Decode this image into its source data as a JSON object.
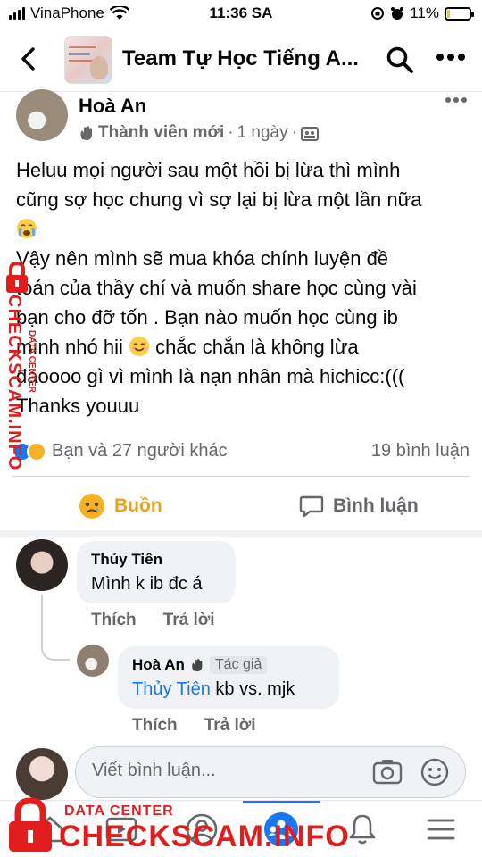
{
  "status_bar": {
    "carrier": "VinaPhone",
    "time": "11:36 SA",
    "battery": "11%",
    "battery_level": 0.11
  },
  "header": {
    "title": "Team Tự Học Tiếng A..."
  },
  "post": {
    "author": "Hoà An",
    "role": "Thành viên mới",
    "separator": "·",
    "time": "1 ngày",
    "body_lines": [
      "Heluu mọi người sau một hồi bị lừa thì mình",
      "cũng sợ học chung vì sợ lại bị lừa một lần nữa",
      "Vậy nên mình sẽ mua khóa chính luyện đề",
      "toán  của thầy chí và muốn share học cùng vài",
      "bạn cho đỡ tốn . Bạn nào muốn học cùng ib",
      "mình nhó hii",
      "chắc chắn là không lừa",
      "đâoooo gì vì mình là nạn nhân mà hichicc:(((",
      "Thanks youuu"
    ],
    "reactions_text": "Bạn và 27 người khác",
    "comments_count": "19 bình luận",
    "actions": {
      "sad_label": "Buồn",
      "comment_label": "Bình luận"
    }
  },
  "comments": [
    {
      "author": "Thủy Tiên",
      "text": "Mình k ib đc á",
      "like_label": "Thích",
      "reply_label": "Trả lời"
    },
    {
      "author": "Hoà An",
      "badge": "Tác giả",
      "mention": "Thủy Tiên",
      "text": " kb vs. mjk",
      "like_label": "Thích",
      "reply_label": "Trả lời"
    }
  ],
  "composer": {
    "placeholder": "Viết bình luận..."
  },
  "watermark": {
    "small": "DATA CENTER",
    "big": "CHECKSCAM.INFO",
    "side": "CHECKSCAM.INFO",
    "side_small": "DATA CENTER"
  },
  "colors": {
    "accent": "#1877f2",
    "sad": "#e9a11b",
    "watermark": "#e11d1d"
  }
}
